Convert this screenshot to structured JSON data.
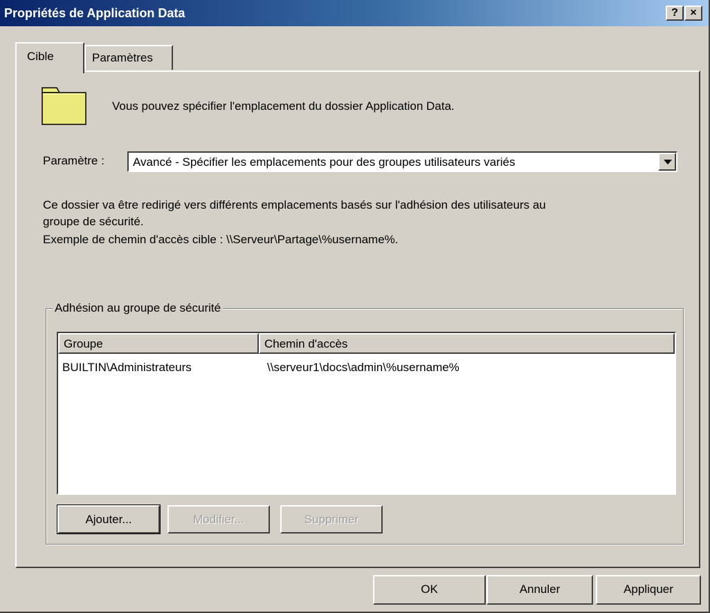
{
  "window": {
    "title": "Propriétés de Application Data",
    "help_button": "?",
    "close_button": "×"
  },
  "tabs": [
    {
      "label": "Cible",
      "active": true
    },
    {
      "label": "Paramètres",
      "active": false
    }
  ],
  "target": {
    "intro_text": "Vous pouvez spécifier l'emplacement du dossier Application Data.",
    "setting_label": "Paramètre :",
    "setting_value": "Avancé - Spécifier les emplacements pour des groupes utilisateurs variés",
    "description_line1": "Ce dossier va être redirigé vers différents emplacements basés sur l'adhésion des utilisateurs au",
    "description_line2": "groupe de sécurité.",
    "example_line": "Exemple de chemin d'accès cible : \\\\Serveur\\Partage\\%username%.",
    "icon": "folder-icon",
    "icon_color": "#ece97c"
  },
  "security_group": {
    "legend": "Adhésion au groupe de sécurité",
    "columns": [
      "Groupe",
      "Chemin d'accès"
    ],
    "rows": [
      {
        "group": "BUILTIN\\Administrateurs",
        "path": "\\\\serveur1\\docs\\admin\\%username%"
      }
    ],
    "buttons": {
      "add": "Ajouter...",
      "modify": "Modifier...",
      "delete": "Supprimer"
    }
  },
  "footer": {
    "ok": "OK",
    "cancel": "Annuler",
    "apply": "Appliquer"
  }
}
